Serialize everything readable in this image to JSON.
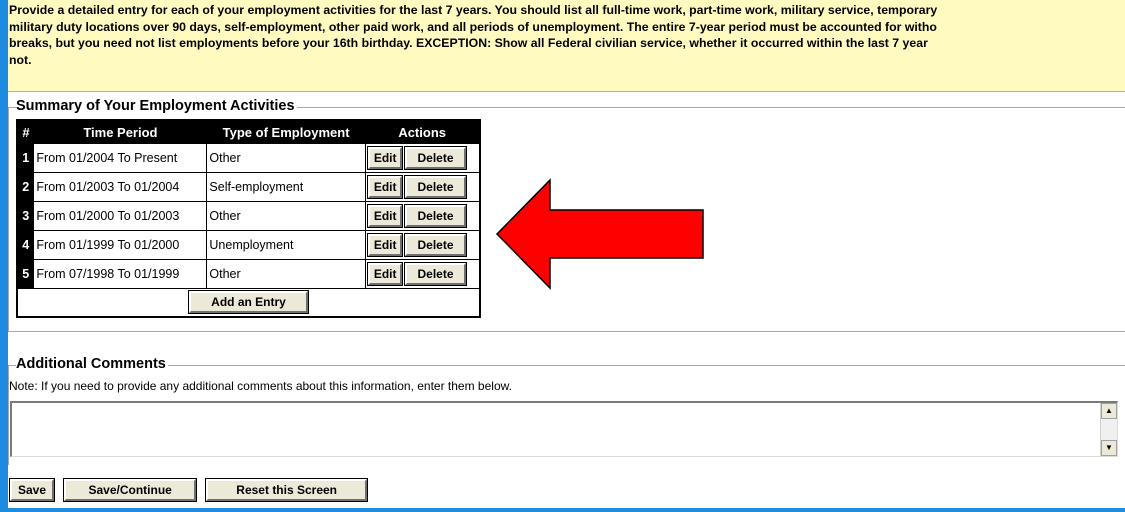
{
  "intro": {
    "text": "Provide a detailed entry for each of your employment activities for the last 7 years. You should list all full-time work, part-time work, military service, temporary\nmilitary duty locations over 90 days, self-employment, other paid work, and all periods of unemployment. The entire 7-year period must be accounted for witho\nbreaks, but you need not list employments before your 16th birthday. EXCEPTION: Show all Federal civilian service, whether it occurred within the last 7 year\nnot."
  },
  "summary": {
    "legend": "Summary of Your Employment Activities",
    "columns": [
      "#",
      "Time Period",
      "Type of Employment",
      "Actions"
    ],
    "rows": [
      {
        "num": "1",
        "period": "From 01/2004 To Present",
        "type": "Other"
      },
      {
        "num": "2",
        "period": "From 01/2003 To 01/2004",
        "type": "Self-employment"
      },
      {
        "num": "3",
        "period": "From 01/2000 To 01/2003",
        "type": "Other"
      },
      {
        "num": "4",
        "period": "From 01/1999 To 01/2000",
        "type": "Unemployment"
      },
      {
        "num": "5",
        "period": "From 07/1998 To 01/1999",
        "type": "Other"
      }
    ],
    "edit_label": "Edit",
    "delete_label": "Delete",
    "add_label": "Add an Entry"
  },
  "annotation": {
    "arrow_color": "#ff0000",
    "arrow_icon": "left-arrow-icon"
  },
  "comments": {
    "legend": "Additional Comments",
    "note": "Note: If you need to provide any additional comments about this information, enter them below.",
    "value": ""
  },
  "buttons": {
    "save": "Save",
    "save_continue": "Save/Continue",
    "reset": "Reset this Screen"
  }
}
